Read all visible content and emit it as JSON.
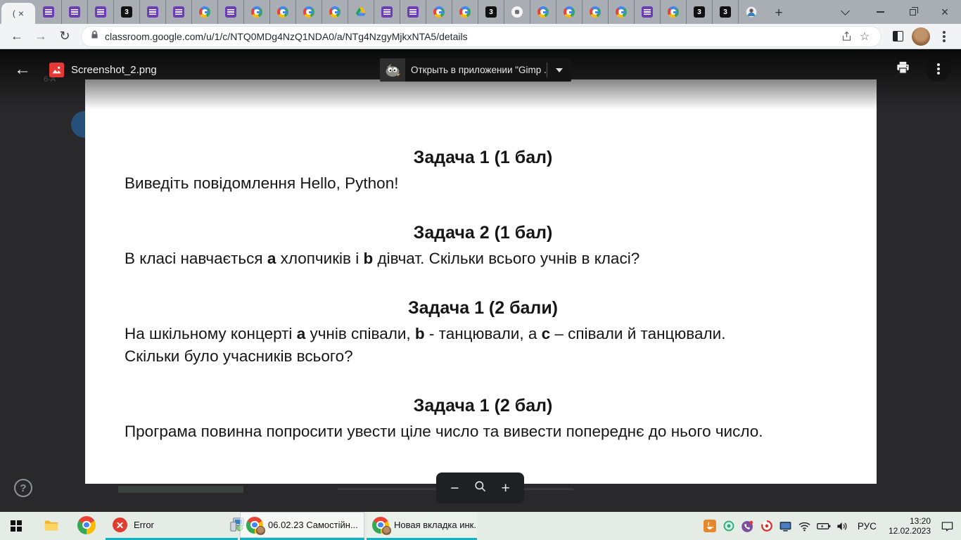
{
  "browser": {
    "active_tab_label": "(",
    "badge_favicon_text": "3",
    "tabs": [
      "form",
      "form",
      "form",
      "num3",
      "form",
      "form",
      "google",
      "form",
      "google",
      "google",
      "google",
      "google",
      "drive",
      "form",
      "form",
      "google",
      "google",
      "num3",
      "site",
      "google",
      "google",
      "google",
      "google",
      "form",
      "google",
      "num3",
      "num3",
      "person"
    ],
    "url": "classroom.google.com/u/1/c/NTQ0MDg4NzQ1NDA0/a/NTg4NzgyMjkxNTA5/details"
  },
  "viewer": {
    "filename": "Screenshot_2.png",
    "open_app_button": "Открыть в приложении \"Gimp ...",
    "zoom_out_label": "−",
    "zoom_in_label": "+",
    "help_label": "?"
  },
  "background_page": {
    "class_label": "6-А"
  },
  "document": {
    "tasks": [
      {
        "title": "Задача 1 (1 бал)",
        "body": [
          {
            "t": "Виведіть повідомлення Hello, Python!"
          }
        ]
      },
      {
        "title": "Задача 2 (1 бал)",
        "body": [
          {
            "t": "В класі навчається "
          },
          {
            "t": "a",
            "b": true
          },
          {
            "t": " хлопчиків і "
          },
          {
            "t": "b",
            "b": true
          },
          {
            "t": " дівчат. Скільки всього учнів в класі?"
          }
        ]
      },
      {
        "title": "Задача 1 (2 бали)",
        "body": [
          {
            "t": "На шкільному концерті "
          },
          {
            "t": "a",
            "b": true
          },
          {
            "t": " учнів співали, "
          },
          {
            "t": "b",
            "b": true
          },
          {
            "t": " - танцювали, а "
          },
          {
            "t": "c",
            "b": true
          },
          {
            "t": " – співали й танцювали."
          },
          {
            "br": true
          },
          {
            "t": "Скільки було учасників всього?"
          }
        ]
      },
      {
        "title": "Задача 1 (2 бал)",
        "body": [
          {
            "t": "Програма повинна попросити увести ціле число та вивести попереднє до нього число."
          }
        ]
      }
    ]
  },
  "taskbar": {
    "error_window_label": "Error",
    "chrome_window_1_label": "06.02.23 Самостійн...",
    "chrome_window_2_label": "Новая вкладка инк...",
    "language_indicator": "РУС",
    "time": "13:20",
    "date": "12.02.2023",
    "tray_icons": [
      "java-icon",
      "antivirus-icon",
      "viber-icon",
      "browser-ring-icon",
      "display-settings-icon",
      "wifi-icon",
      "battery-icon",
      "volume-icon"
    ]
  },
  "colors": {
    "taskbar_accent_teal": "#0fb3c6",
    "overlay_background": "#29292b",
    "taskbar_background": "#e4ece5",
    "forms_favicon_purple": "#6d3db8"
  }
}
